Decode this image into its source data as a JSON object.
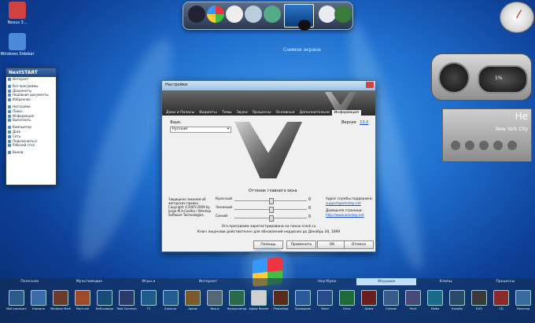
{
  "desktop": {
    "icons": [
      {
        "label": "Nexus 3...",
        "icon": "app-icon",
        "color": "#d24141"
      },
      {
        "label": "Windows Sidebar",
        "icon": "sidebar-icon",
        "color": "#4a8ad8"
      }
    ]
  },
  "top_dock": {
    "items": [
      "nexus-icon",
      "windows-logo-icon",
      "clock-icon",
      "recycle-bin-icon",
      "globe-icon",
      "photo-icon",
      "camera-icon",
      "clock-icon-2",
      "tree-icon"
    ],
    "caption": "Снимок экрана"
  },
  "start_menu": {
    "title": "NextSTART",
    "items": [
      "Интернет",
      "Все программы",
      "Документы",
      "Недавние документы",
      "Избранное",
      "Настройки",
      "Поиск",
      "Информация",
      "Выполнить",
      "Компьютер",
      "Диск",
      "Сеть",
      "Подключиться",
      "Рабочий стол",
      "Выход"
    ]
  },
  "dialog": {
    "title": "Настройки",
    "tabs": [
      "Доки и Полосы",
      "Виджеты",
      "Темы",
      "Звуки",
      "Процессы",
      "Основные",
      "Дополнительно",
      "Информация"
    ],
    "active_tab": "Информация",
    "lang_label": "Язык:",
    "lang_value": "Русский",
    "version_label": "Версия",
    "version_value": "10.0",
    "color_title": "Оттенок главного окна",
    "sliders": [
      {
        "label": "Красный",
        "value": "0"
      },
      {
        "label": "Зеленый",
        "value": "0"
      },
      {
        "label": "Синий",
        "value": "0"
      }
    ],
    "copyright": "Защищено законом об авторских правах. Copyright ©2005-2009 by Jorge M.A.Coelho / Winstep Software Technologies.",
    "support_label": "Адрес службы поддержки:",
    "support_link": "support@winstep.net",
    "home_label": "Домашняя страница:",
    "home_link": "http://www.winstep.net",
    "registered_text": "Эта программа зарегистрирована на nexus-crack.ru",
    "license_text": "Ключ лицензии действителен для обновлений недавних до Декабрь 30, 1899",
    "buttons": [
      "Помощь",
      "Применить",
      "OK",
      "Отмена"
    ]
  },
  "gadgets": {
    "cpu_percent": "1%",
    "weather_temp": "Не",
    "weather_city": "New York City"
  },
  "bottom_bar": {
    "tabs": [
      "Полезное",
      "Мультимедиа",
      "Игры и",
      "Интернет",
      "",
      "Ноутбуки",
      "Игрушки",
      "Клипы",
      "Процессы"
    ],
    "active_tab_index": 4,
    "items": [
      {
        "label": "Мой компьютер",
        "color": "#2b5b8a"
      },
      {
        "label": "Корзина",
        "color": "#3c6aa8"
      },
      {
        "label": "Windows Media",
        "color": "#6a3a2a"
      },
      {
        "label": "Paint.net",
        "color": "#a04a2a"
      },
      {
        "label": "Веб-камера",
        "color": "#1a4a7a"
      },
      {
        "label": "Total Commander",
        "color": "#2a3a6a"
      },
      {
        "label": "TV",
        "color": "#1e5a8a"
      },
      {
        "label": "Блокнот",
        "color": "#235c8f"
      },
      {
        "label": "Архив",
        "color": "#7a5a2a"
      },
      {
        "label": "Nexus",
        "color": "#556677"
      },
      {
        "label": "Калькулятор",
        "color": "#2a6a4a"
      },
      {
        "label": "Adobe Reader",
        "color": "#d0d0d0"
      },
      {
        "label": "Photoshop",
        "color": "#5a2a1a"
      },
      {
        "label": "Проводник",
        "color": "#2a5a9a"
      },
      {
        "label": "Word",
        "color": "#2a4a8a"
      },
      {
        "label": "Excel",
        "color": "#1e6a3a"
      },
      {
        "label": "Opera",
        "color": "#6a1e1e"
      },
      {
        "label": "Outlook",
        "color": "#3a5a8a"
      },
      {
        "label": "Paint",
        "color": "#4a4a7a"
      },
      {
        "label": "Media",
        "color": "#1a6a8a"
      },
      {
        "label": "Калибр",
        "color": "#2a4a6a"
      },
      {
        "label": "DVD",
        "color": "#3a3a3a"
      },
      {
        "label": "CD",
        "color": "#8a2a2a"
      },
      {
        "label": "Монитор",
        "color": "#3a6aa0"
      }
    ]
  }
}
